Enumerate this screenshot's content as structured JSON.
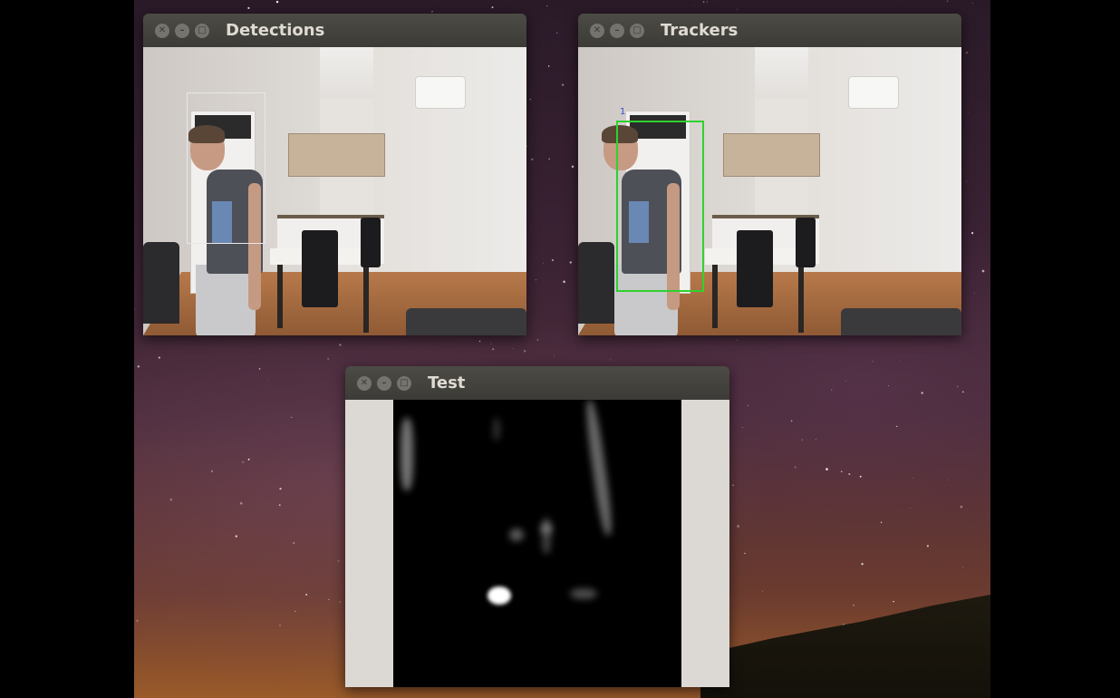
{
  "windows": {
    "detections": {
      "title": "Detections",
      "box_color": "#e8e8e8"
    },
    "trackers": {
      "title": "Trackers",
      "box_color": "#2fd12f",
      "track_id": "1"
    },
    "test": {
      "title": "Test"
    }
  },
  "titlebar_buttons": {
    "close_icon": "close-icon",
    "minimize_icon": "minimize-icon",
    "maximize_icon": "maximize-icon"
  }
}
